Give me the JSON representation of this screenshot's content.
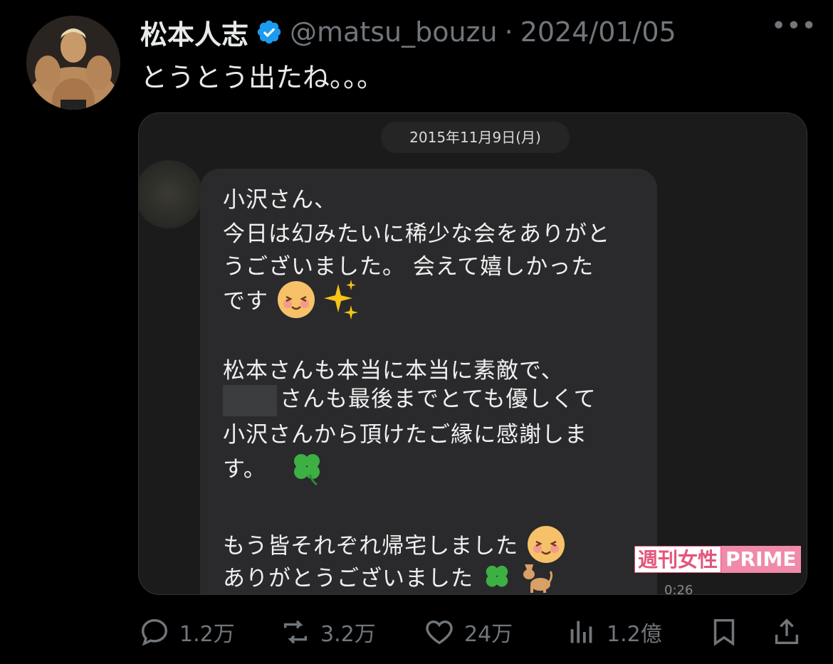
{
  "tweet": {
    "author_name": "松本人志",
    "handle": "@matsu_bouzu",
    "separator": "·",
    "date": "2024/01/05",
    "more_label": "•••",
    "text": "とうとう出たね。。。"
  },
  "media": {
    "date_pill": "2015年11月9日(月)",
    "lines": [
      "小沢さん、",
      "今日は幻みたいに稀少な会をありがと",
      "うございました。 会えて嬉しかった",
      "です",
      "松本さんも本当に本当に素敵で、",
      "さんも最後までとても優しくて",
      "小沢さんから頂けたご縁に感謝しま",
      "す。",
      "もう皆それぞれ帰宅しました",
      "ありがとうございました"
    ],
    "watermark_left": "週刊女性",
    "watermark_right": "PRIME",
    "video_time": "0:26"
  },
  "actions": {
    "replies": "1.2万",
    "retweets": "3.2万",
    "likes": "24万",
    "views": "1.2億"
  },
  "colors": {
    "verified": "#1d9bf0",
    "muted": "#71767b",
    "text": "#e7e9ea"
  }
}
